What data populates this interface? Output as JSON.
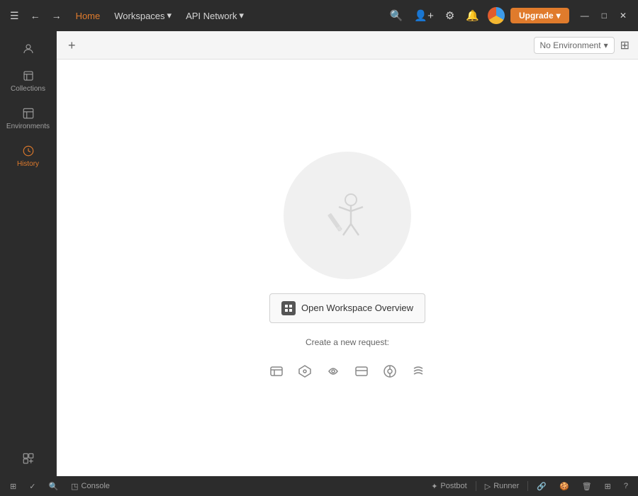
{
  "titleBar": {
    "hamburger": "☰",
    "back": "←",
    "forward": "→",
    "home": "Home",
    "workspaces": "Workspaces",
    "workspacesChevron": "▾",
    "apiNetwork": "API Network",
    "apiNetworkChevron": "▾",
    "search": "🔍",
    "invite": "👤+",
    "settings": "⚙",
    "bell": "🔔",
    "upgrade": "Upgrade",
    "upgradeChevron": "▾",
    "minimize": "—",
    "maximize": "□",
    "close": "✕"
  },
  "sidebar": {
    "items": [
      {
        "id": "account",
        "label": "",
        "icon": "person"
      },
      {
        "id": "collections",
        "label": "Collections",
        "icon": "trash"
      },
      {
        "id": "environments",
        "label": "Environments",
        "icon": "env"
      },
      {
        "id": "history",
        "label": "History",
        "icon": "clock",
        "active": true
      },
      {
        "id": "add",
        "label": "",
        "icon": "grid-add"
      }
    ]
  },
  "tabBar": {
    "addLabel": "+",
    "envSelector": {
      "label": "No Environment",
      "chevron": "▾"
    },
    "gridView": "⊞"
  },
  "mainContent": {
    "openWorkspaceBtnLabel": "Open Workspace Overview",
    "createRequestLabel": "Create a new request:",
    "requestIcons": [
      {
        "id": "http",
        "symbol": "⊞",
        "tooltip": "HTTP"
      },
      {
        "id": "graphql",
        "symbol": "✦",
        "tooltip": "GraphQL"
      },
      {
        "id": "grpc",
        "symbol": "⋔",
        "tooltip": "gRPC"
      },
      {
        "id": "socket",
        "symbol": "◫",
        "tooltip": "WebSocket"
      },
      {
        "id": "mqtt",
        "symbol": "⦿",
        "tooltip": "MQTT"
      },
      {
        "id": "socketio",
        "symbol": "≋",
        "tooltip": "Socket.IO"
      }
    ]
  },
  "statusBar": {
    "bootcamp": "⊞",
    "check": "✓",
    "search": "🔍",
    "console": "Console",
    "consoleIcon": "◳",
    "postbot": "Postbot",
    "postbotIcon": "✦",
    "runner": "Runner",
    "runnerIcon": "▷",
    "link": "🔗",
    "cookie": "🍪",
    "trash": "🗑",
    "grid": "⊞",
    "help": "?"
  }
}
